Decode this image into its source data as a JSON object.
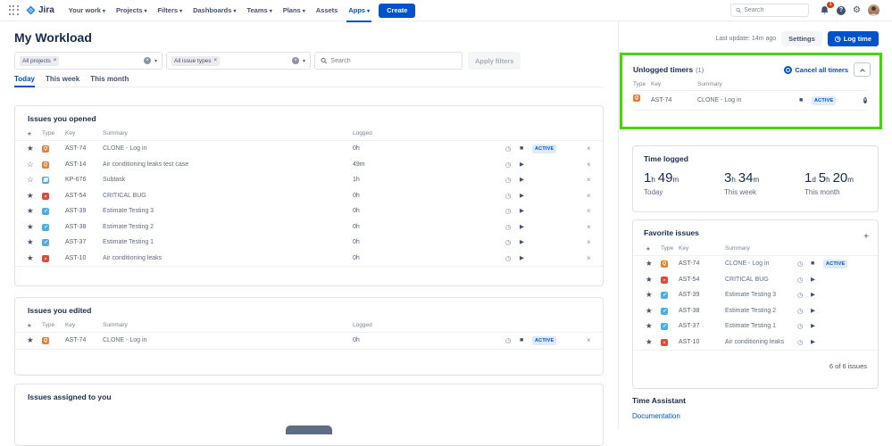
{
  "nav": {
    "app_name": "Jira",
    "items": [
      {
        "label": "Your work",
        "dropdown": true
      },
      {
        "label": "Projects",
        "dropdown": true
      },
      {
        "label": "Filters",
        "dropdown": true
      },
      {
        "label": "Dashboards",
        "dropdown": true
      },
      {
        "label": "Teams",
        "dropdown": true
      },
      {
        "label": "Plans",
        "dropdown": true
      },
      {
        "label": "Assets",
        "dropdown": false
      },
      {
        "label": "Apps",
        "dropdown": true,
        "active": true
      }
    ],
    "create_label": "Create",
    "search_placeholder": "Search",
    "notification_count": "1"
  },
  "header": {
    "title": "My Workload",
    "last_update": "Last update: 14m ago",
    "settings_label": "Settings",
    "log_time_label": "Log time"
  },
  "filters": {
    "projects_tag": "All projects",
    "issue_types_tag": "All issue types",
    "search_placeholder": "Search",
    "apply_label": "Apply filters"
  },
  "tabs": [
    {
      "label": "Today",
      "active": true
    },
    {
      "label": "This week"
    },
    {
      "label": "This month"
    }
  ],
  "labels": {
    "active_badge": "ACTIVE",
    "star_col": "★"
  },
  "columns": {
    "type": "Type",
    "key": "Key",
    "summary": "Summary",
    "logged": "Logged"
  },
  "sections": {
    "opened": {
      "title": "Issues you opened",
      "rows": [
        {
          "starred": true,
          "type": "testcase",
          "key": "AST-74",
          "summary": "CLONE - Log in",
          "logged": "0h",
          "active": true
        },
        {
          "starred": false,
          "type": "testcase",
          "key": "AST-14",
          "summary": "Air conditioning leaks test case",
          "logged": "49m",
          "active": false
        },
        {
          "starred": false,
          "type": "subtask",
          "key": "KP-676",
          "summary": "Subtask",
          "logged": "1h",
          "active": false
        },
        {
          "starred": true,
          "type": "bug",
          "key": "AST-54",
          "summary": "CRITICAL BUG",
          "logged": "0h",
          "active": false
        },
        {
          "starred": true,
          "type": "task",
          "key": "AST-39",
          "summary": "Estimate Testing 3",
          "logged": "0h",
          "active": false
        },
        {
          "starred": true,
          "type": "task",
          "key": "AST-38",
          "summary": "Estimate Testing 2",
          "logged": "0h",
          "active": false
        },
        {
          "starred": true,
          "type": "task",
          "key": "AST-37",
          "summary": "Estimate Testing 1",
          "logged": "0h",
          "active": false
        },
        {
          "starred": true,
          "type": "bug",
          "key": "AST-10",
          "summary": "Air conditioning leaks",
          "logged": "0h",
          "active": false
        }
      ]
    },
    "edited": {
      "title": "Issues you edited",
      "rows": [
        {
          "starred": true,
          "type": "testcase",
          "key": "AST-74",
          "summary": "CLONE - Log in",
          "logged": "0h",
          "active": true
        }
      ]
    },
    "assigned": {
      "title": "Issues assigned to you"
    }
  },
  "right": {
    "unlogged": {
      "title": "Unlogged timers",
      "count": "(1)",
      "cancel_all_label": "Cancel all timers",
      "rows": [
        {
          "type": "testcase",
          "key": "AST-74",
          "summary": "CLONE - Log in",
          "active": true
        }
      ]
    },
    "time_logged": {
      "title": "Time logged",
      "stats": [
        {
          "parts": [
            {
              "num": "1",
              "unit": "h"
            },
            {
              "num": "49",
              "unit": "m"
            }
          ],
          "label": "Today"
        },
        {
          "parts": [
            {
              "num": "3",
              "unit": "h"
            },
            {
              "num": "34",
              "unit": "m"
            }
          ],
          "label": "This week"
        },
        {
          "parts": [
            {
              "num": "1",
              "unit": "d"
            },
            {
              "num": "5",
              "unit": "h"
            },
            {
              "num": "20",
              "unit": "m"
            }
          ],
          "label": "This month"
        }
      ]
    },
    "favorites": {
      "title": "Favorite issues",
      "footer": "6 of 6 issues",
      "rows": [
        {
          "starred": true,
          "type": "testcase",
          "key": "AST-74",
          "summary": "CLONE - Log in",
          "active": true
        },
        {
          "starred": true,
          "type": "bug",
          "key": "AST-54",
          "summary": "CRITICAL BUG",
          "active": false
        },
        {
          "starred": true,
          "type": "task",
          "key": "AST-39",
          "summary": "Estimate Testing 3",
          "active": false
        },
        {
          "starred": true,
          "type": "task",
          "key": "AST-38",
          "summary": "Estimate Testing 2",
          "active": false
        },
        {
          "starred": true,
          "type": "task",
          "key": "AST-37",
          "summary": "Estimate Testing 1",
          "active": false
        },
        {
          "starred": true,
          "type": "bug",
          "key": "AST-10",
          "summary": "Air conditioning leaks",
          "active": false
        }
      ]
    },
    "time_assistant_title": "Time Assistant",
    "documentation_label": "Documentation"
  }
}
